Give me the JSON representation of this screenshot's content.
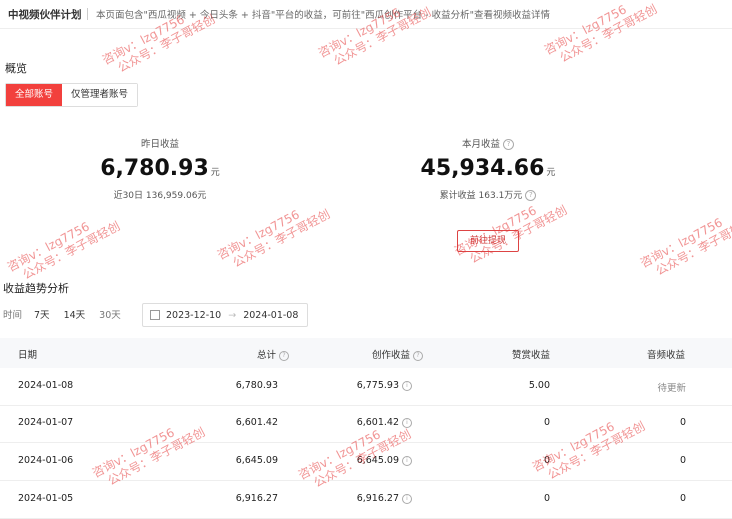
{
  "header": {
    "title": "中视频伙伴计划",
    "notice": "本页面包含\"西瓜视频 + 今日头条 + 抖音\"平台的收益，可前往\"西瓜创作平台 - 收益分析\"查看视频收益详情"
  },
  "overview": {
    "title": "概览",
    "tabs": [
      "全部账号",
      "仅管理者账号"
    ],
    "yesterday": {
      "label": "昨日收益",
      "value": "6,780.93",
      "unit": "元",
      "sub": "近30日 136,959.06元"
    },
    "month": {
      "label": "本月收益",
      "value": "45,934.66",
      "unit": "元",
      "sub": "累计收益 163.1万元"
    },
    "withdraw_label": "前往提现"
  },
  "trend": {
    "title": "收益趋势分析",
    "time_label": "时间",
    "ranges": [
      "7天",
      "14天",
      "30天"
    ],
    "date_start": "2023-12-10",
    "date_end": "2024-01-08"
  },
  "table": {
    "headers": [
      "日期",
      "总计",
      "创作收益",
      "赞赏收益",
      "音频收益"
    ],
    "rows": [
      [
        "2024-01-08",
        "6,780.93",
        "6,775.93",
        "5.00",
        "待更新"
      ],
      [
        "2024-01-07",
        "6,601.42",
        "6,601.42",
        "0",
        "0"
      ],
      [
        "2024-01-06",
        "6,645.09",
        "6,645.09",
        "0",
        "0"
      ],
      [
        "2024-01-05",
        "6,916.27",
        "6,916.27",
        "0",
        "0"
      ]
    ]
  },
  "watermark": {
    "line1": "咨询v：lzg7756",
    "line2": "公众号：李子哥轻创"
  }
}
